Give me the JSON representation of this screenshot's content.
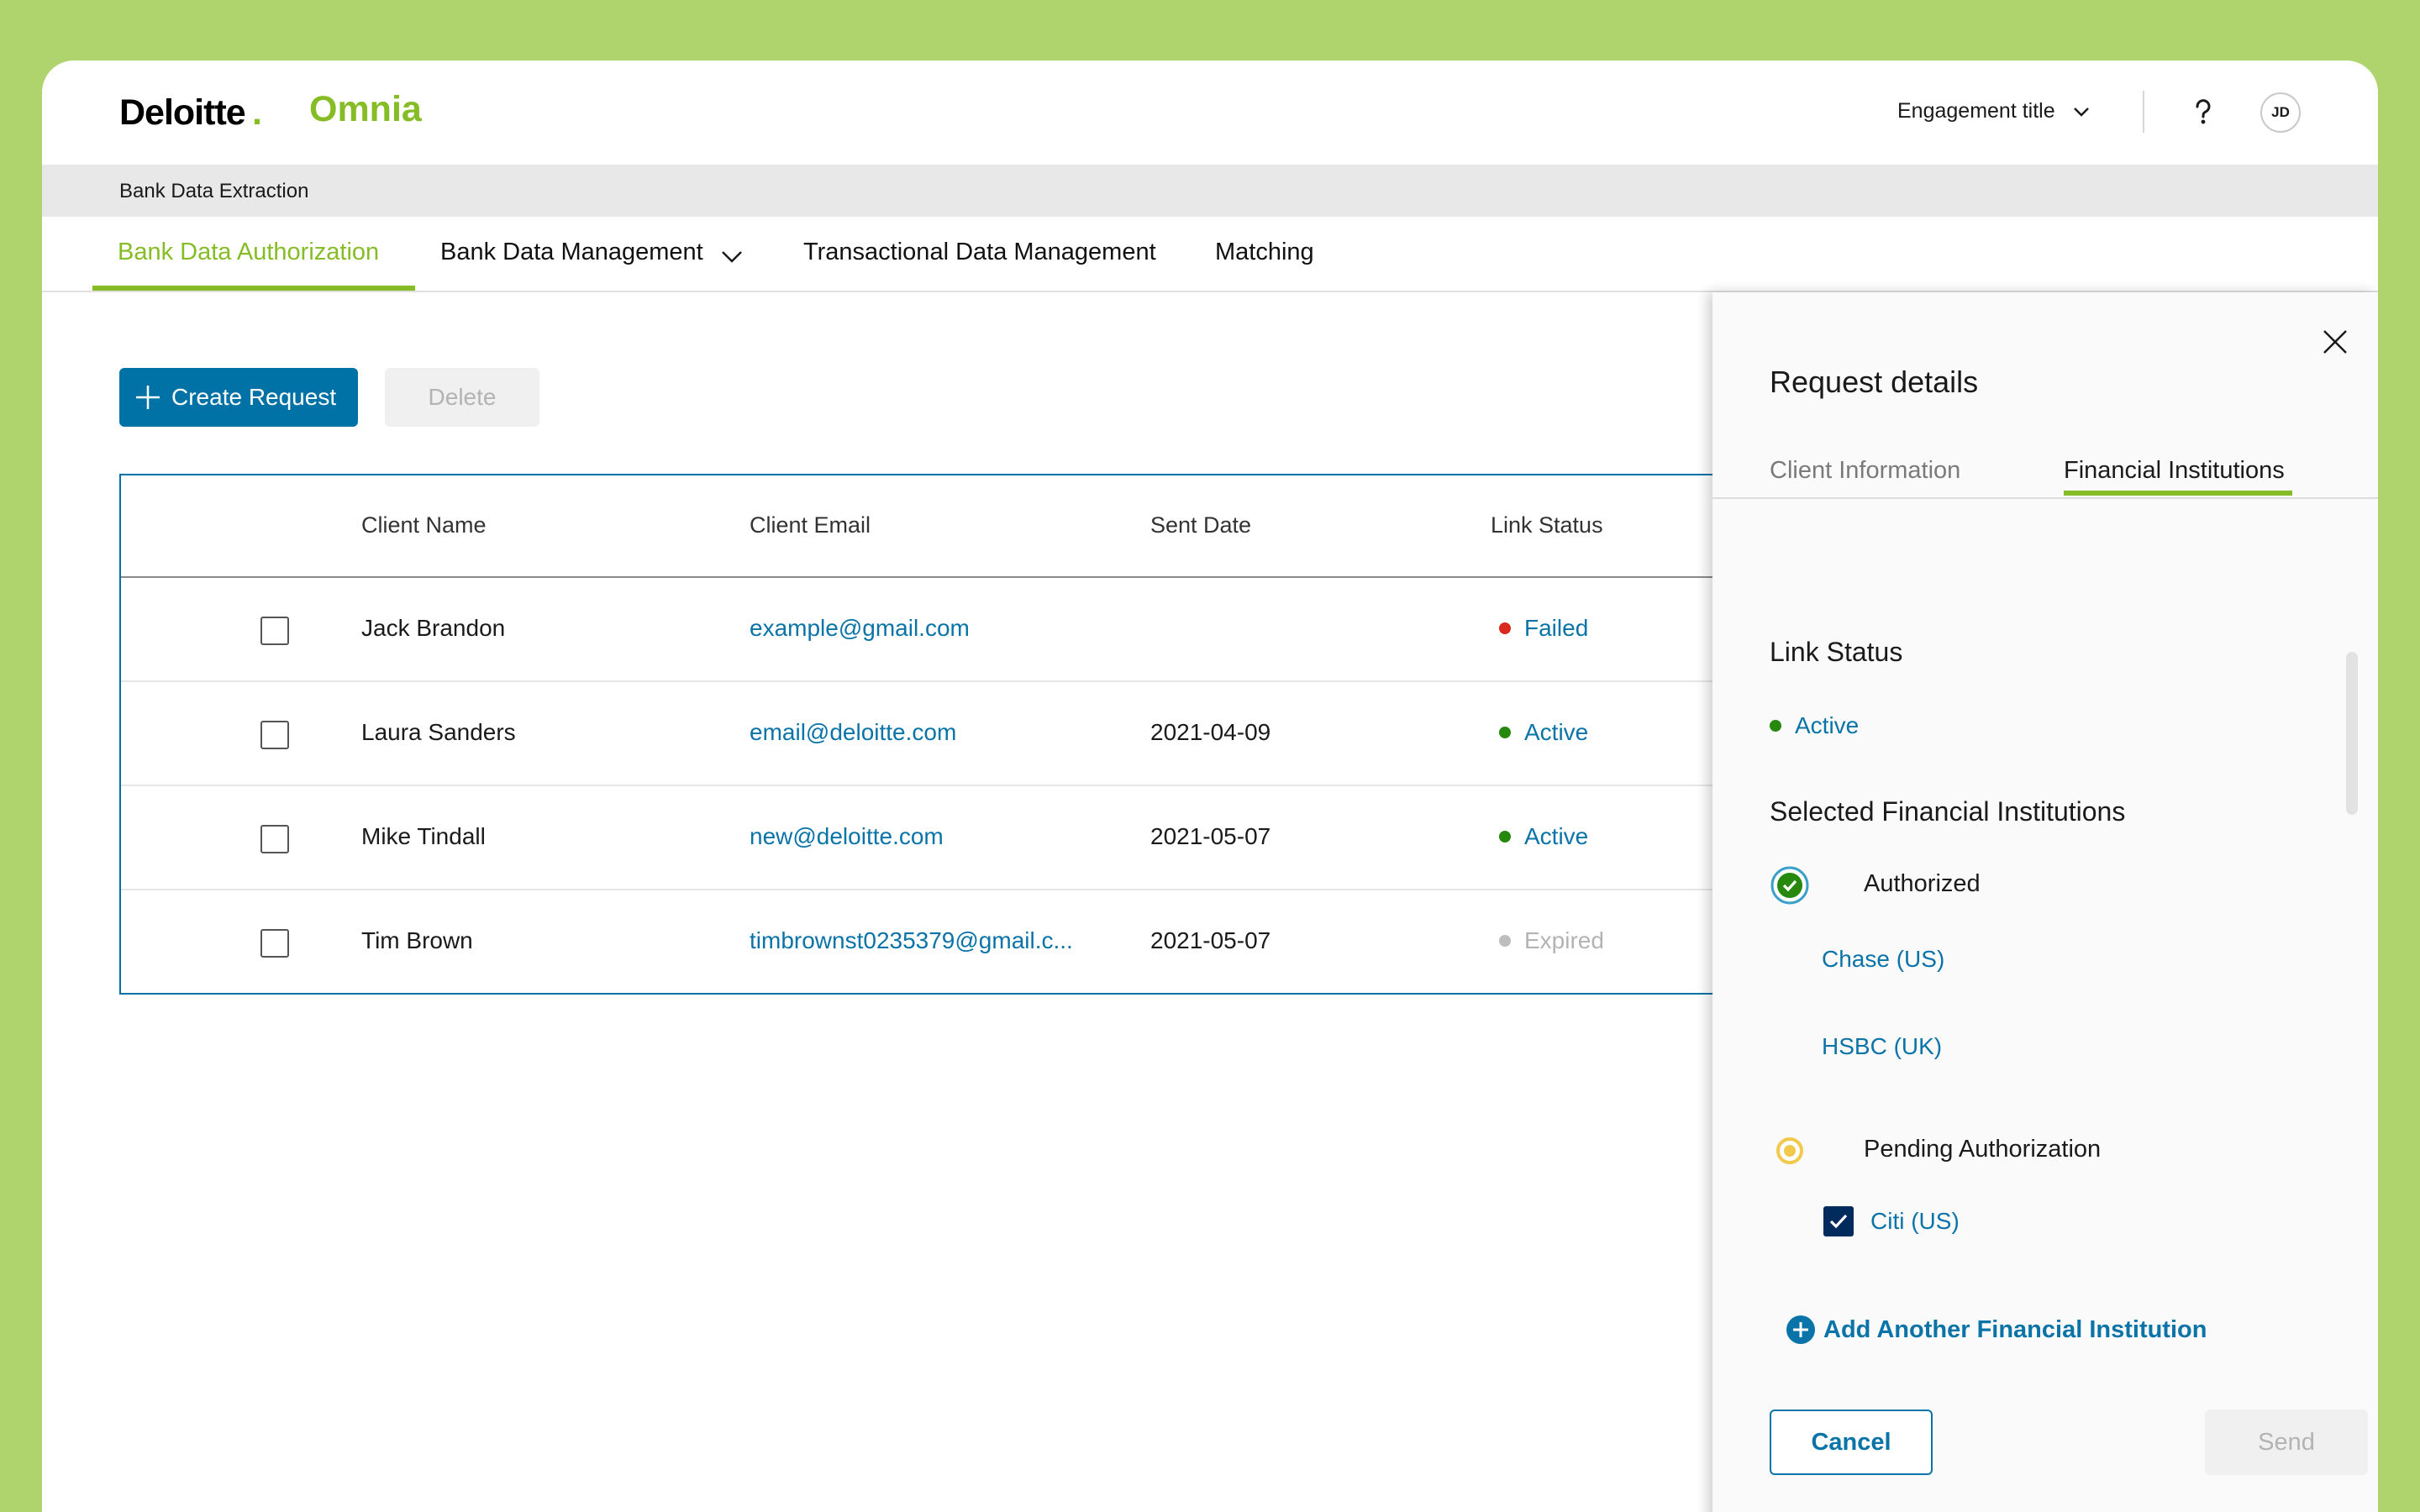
{
  "header": {
    "brand": "Deloitte",
    "brand_dot": ".",
    "product": "Omnia",
    "engagement_label": "Engagement title",
    "avatar_initials": "JD"
  },
  "breadcrumb": "Bank Data Extraction",
  "nav": {
    "tabs": [
      {
        "label": "Bank Data Authorization",
        "active": true
      },
      {
        "label": "Bank Data Management",
        "dropdown": true
      },
      {
        "label": "Transactional Data Management"
      },
      {
        "label": "Matching"
      }
    ]
  },
  "toolbar": {
    "create_label": "Create Request",
    "delete_label": "Delete"
  },
  "table": {
    "columns": [
      "Client Name",
      "Client Email",
      "Sent Date",
      "Link Status"
    ],
    "rows": [
      {
        "name": "Jack Brandon",
        "email": "example@gmail.com",
        "sent": "",
        "status": "Failed"
      },
      {
        "name": "Laura Sanders",
        "email": "email@deloitte.com",
        "sent": "2021-04-09",
        "status": "Active"
      },
      {
        "name": "Mike Tindall",
        "email": "new@deloitte.com",
        "sent": "2021-05-07",
        "status": "Active"
      },
      {
        "name": "Tim Brown",
        "email": "timbrownst0235379@gmail.c...",
        "sent": "2021-05-07",
        "status": "Expired"
      }
    ]
  },
  "status_colors": {
    "Failed": "#da291c",
    "Active": "#26890d",
    "Expired": "#bdbdbd"
  },
  "status_text_colors": {
    "Failed": "#0a73a8",
    "Active": "#0a73a8",
    "Expired": "#b3b3b3"
  },
  "panel": {
    "title": "Request details",
    "tabs": [
      {
        "label": "Client Information",
        "active": false
      },
      {
        "label": "Financial Institutions",
        "active": true
      }
    ],
    "link_status_heading": "Link Status",
    "link_status_value": "Active",
    "selected_heading": "Selected Financial Institutions",
    "authorized_label": "Authorized",
    "authorized_items": [
      "Chase (US)",
      "HSBC  (UK)"
    ],
    "pending_label": "Pending Authorization",
    "pending_items": [
      "Citi  (US)"
    ],
    "add_label": "Add Another Financial Institution",
    "cancel_label": "Cancel",
    "send_label": "Send"
  },
  "colors": {
    "accent_green": "#86bc25",
    "primary_blue": "#0072a6",
    "link_blue": "#0a73a8",
    "background": "#afd46e"
  }
}
